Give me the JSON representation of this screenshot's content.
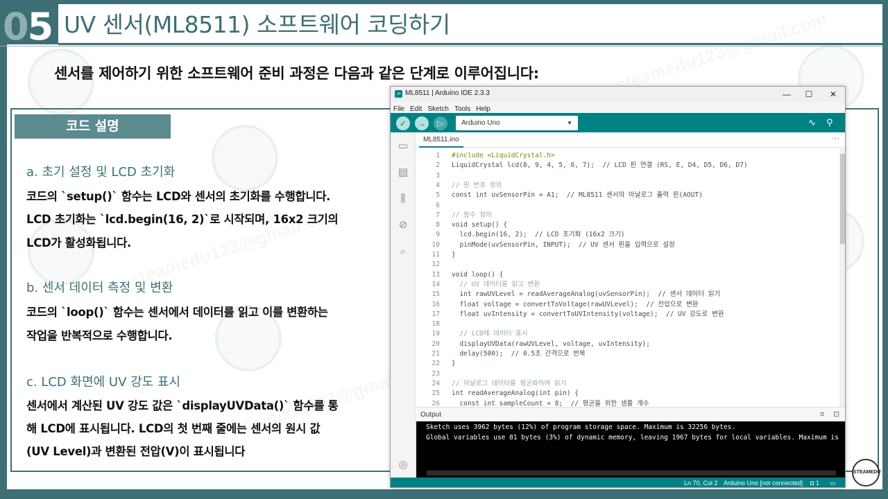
{
  "slide": {
    "number_tens": "0",
    "number_ones": "5",
    "title": "UV 센서(ML8511) 소프트웨어 코딩하기",
    "subtitle": "센서를 제어하기 위한 소프트웨어 준비 과정은 다음과 같은 단계로 이루어집니다:",
    "section_tag": "코드 설명"
  },
  "sections": [
    {
      "heading": "a. 초기 설정 및 LCD 초기화",
      "lines": [
        "코드의 `setup()` 함수는 LCD와 센서의 초기화를 수행합니다.",
        "LCD 초기화는 `lcd.begin(16, 2)`로 시작되며, 16x2 크기의",
        "LCD가 활성화됩니다."
      ]
    },
    {
      "heading": "b. 센서 데이터 측정 및 변환",
      "lines": [
        "코드의 `loop()` 함수는 센서에서 데이터를 읽고 이를 변환하는",
        "작업을 반복적으로 수행합니다."
      ]
    },
    {
      "heading": "c. LCD 화면에 UV 강도 표시",
      "lines": [
        "센서에서 계산된 UV 강도 값은 `displayUVData()` 함수를 통",
        "해 LCD에 표시됩니다. LCD의 첫 번째 줄에는 센서의 원시 값",
        "(UV Level)과 변환된 전압(V)이 표시됩니다"
      ]
    }
  ],
  "ide": {
    "window_title": "ML8511 | Arduino IDE 2.3.3",
    "window_controls": [
      "—",
      "☐",
      "✕"
    ],
    "menu": [
      "File",
      "Edit",
      "Sketch",
      "Tools",
      "Help"
    ],
    "board": "Arduino Uno",
    "file_tab": "ML8511.ino",
    "tab_more": "···",
    "code": [
      {
        "n": "1",
        "t": "#include <LiquidCrystal.h>"
      },
      {
        "n": "2",
        "t": "LiquidCrystal lcd(8, 9, 4, 5, 6, 7);  // LCD 핀 연결 (RS, E, D4, D5, D6, D7)"
      },
      {
        "n": "3",
        "t": ""
      },
      {
        "n": "4",
        "t": "// 핀 번호 정의"
      },
      {
        "n": "5",
        "t": "const int uvSensorPin = A1;  // ML8511 센서의 아날로그 출력 핀(AOUT)"
      },
      {
        "n": "6",
        "t": ""
      },
      {
        "n": "7",
        "t": "// 함수 정의"
      },
      {
        "n": "8",
        "t": "void setup() {"
      },
      {
        "n": "9",
        "t": "  lcd.begin(16, 2);  // LCD 초기화 (16x2 크기)"
      },
      {
        "n": "10",
        "t": "  pinMode(uvSensorPin, INPUT);  // UV 센서 핀을 입력으로 설정"
      },
      {
        "n": "11",
        "t": "}"
      },
      {
        "n": "12",
        "t": ""
      },
      {
        "n": "13",
        "t": "void loop() {"
      },
      {
        "n": "14",
        "t": "  // UV 데이터를 읽고 변환"
      },
      {
        "n": "15",
        "t": "  int rawUVLevel = readAverageAnalog(uvSensorPin);  // 센서 데이터 읽기"
      },
      {
        "n": "16",
        "t": "  float voltage = convertToVoltage(rawUVLevel);  // 전압으로 변환"
      },
      {
        "n": "17",
        "t": "  float uvIntensity = convertToUVIntensity(voltage);  // UV 강도로 변환"
      },
      {
        "n": "18",
        "t": ""
      },
      {
        "n": "19",
        "t": "  // LCD에 데이터 표시"
      },
      {
        "n": "20",
        "t": "  displayUVData(rawUVLevel, voltage, uvIntensity);"
      },
      {
        "n": "21",
        "t": "  delay(500);  // 0.5초 간격으로 반복"
      },
      {
        "n": "22",
        "t": "}"
      },
      {
        "n": "23",
        "t": ""
      },
      {
        "n": "24",
        "t": "// 아날로그 데이터를 평균화하여 읽기"
      },
      {
        "n": "25",
        "t": "int readAverageAnalog(int pin) {"
      },
      {
        "n": "26",
        "t": "  const int sampleCount = 8;  // 평균을 위한 샘플 개수"
      }
    ],
    "output_title": "Output",
    "output_lines": [
      "Sketch uses 3962 bytes (12%) of program storage space. Maximum is 32256 bytes.",
      "Global variables use 81 bytes (3%) of dynamic memory, leaving 1967 bytes for local variables. Maximum is"
    ],
    "status_position": "Ln 70, Col 2",
    "status_board": "Arduino Uno [not connected]",
    "status_notifications": "1"
  },
  "watermark_text": "steamedu123@gmail.com",
  "corner_logo_text": "STEAMEDU",
  "colors": {
    "frame": "#3d6f74",
    "section_tag": "#5b8a8f",
    "ide_toolbar": "#008184",
    "output_bg": "#000000"
  }
}
